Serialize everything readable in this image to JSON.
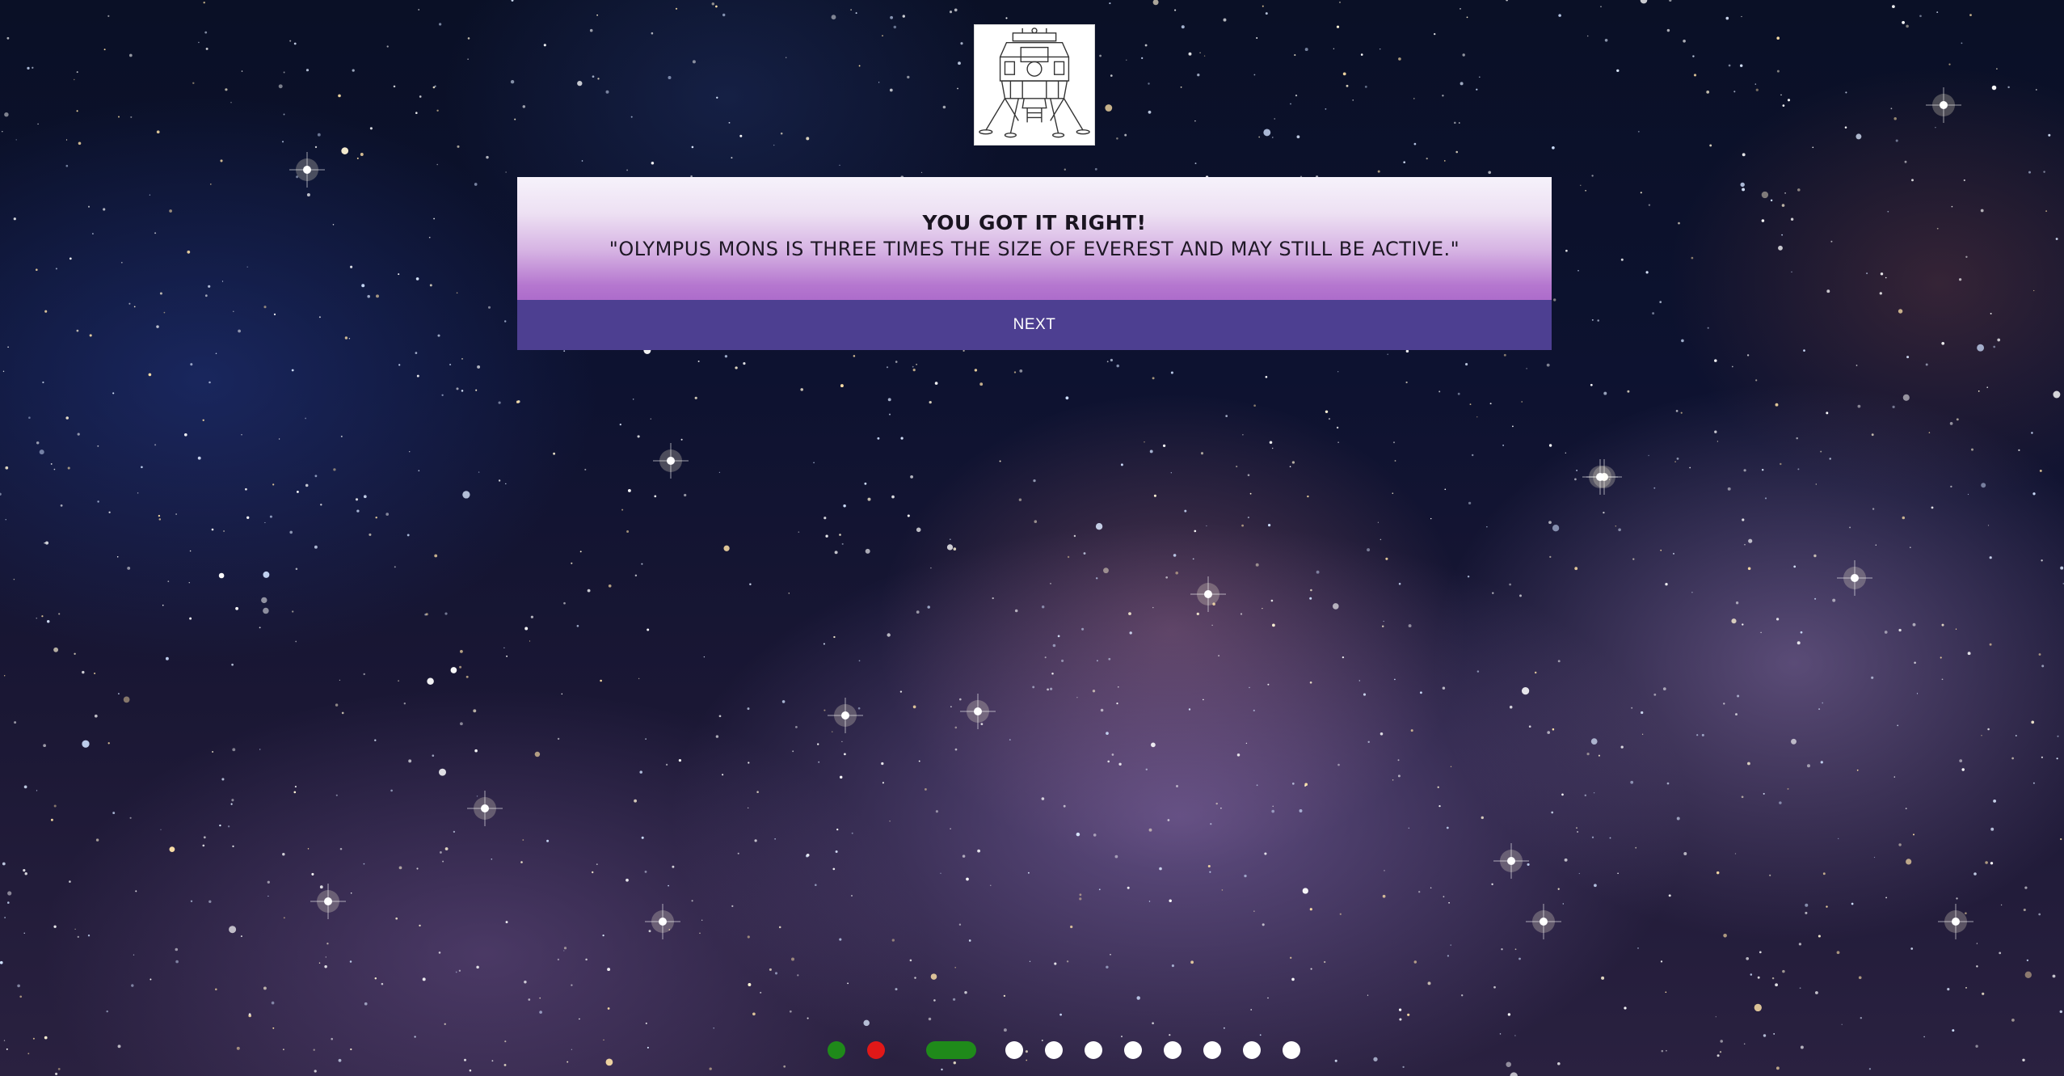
{
  "quiz": {
    "result_title": "YOU GOT IT RIGHT!",
    "fact_text": "\"OLYMPUS MONS IS THREE TIMES THE SIZE OF EVEREST AND MAY STILL BE ACTIVE.\"",
    "next_label": "NEXT"
  },
  "logo": {
    "icon": "lunar-lander-icon"
  },
  "progress": {
    "total_questions": 11,
    "current_question": 3,
    "states": [
      "correct",
      "wrong",
      "current",
      "pending",
      "pending",
      "pending",
      "pending",
      "pending",
      "pending",
      "pending",
      "pending"
    ]
  },
  "colors": {
    "card_gradient_top": "#f6f2fb",
    "card_gradient_bottom": "#ad6ccb",
    "button_bg": "#4d3f91",
    "correct": "#1f8a1a",
    "wrong": "#e01818",
    "pending": "#ffffff"
  }
}
